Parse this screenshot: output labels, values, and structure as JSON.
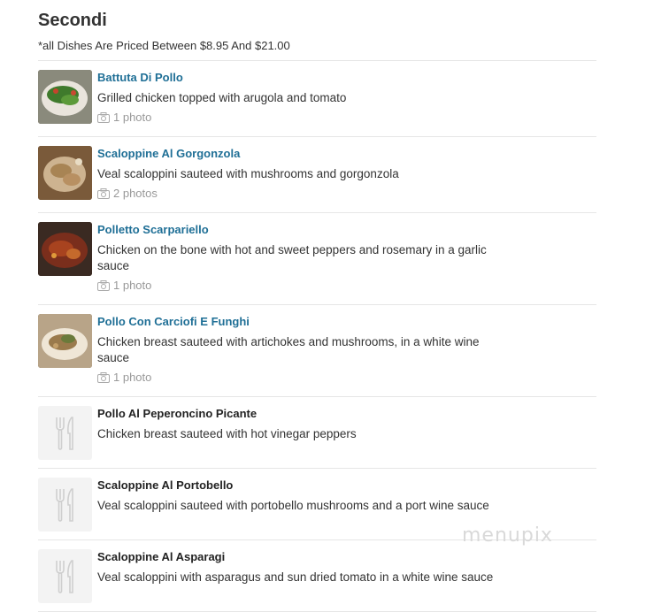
{
  "section": {
    "title": "Secondi",
    "note": "*all Dishes Are Priced Between $8.95 And $21.00"
  },
  "items": [
    {
      "name": "Battuta Di Pollo",
      "description": "Grilled chicken topped with arugola and tomato",
      "photos": "1 photo"
    },
    {
      "name": "Scaloppine Al Gorgonzola",
      "description": "Veal scaloppini sauteed with mushrooms and gorgonzola",
      "photos": "2 photos"
    },
    {
      "name": "Polletto Scarpariello",
      "description": "Chicken on the bone with hot and sweet peppers and rosemary in a garlic sauce",
      "photos": "1 photo"
    },
    {
      "name": "Pollo Con Carciofi E Funghi",
      "description": "Chicken breast sauteed with artichokes and mushrooms, in a white wine sauce",
      "photos": "1 photo"
    },
    {
      "name": "Pollo Al Peperoncino Picante",
      "description": "Chicken breast sauteed with hot vinegar peppers"
    },
    {
      "name": "Scaloppine Al Portobello",
      "description": "Veal scaloppini sauteed with portobello mushrooms and a port wine sauce"
    },
    {
      "name": "Scaloppine Al Asparagi",
      "description": "Veal scaloppini with asparagus and sun dried tomato in a white wine sauce"
    }
  ],
  "watermark": "menupix",
  "colors": {
    "link": "#1f6f96",
    "divider": "#e6e6e6",
    "muted": "#999999"
  }
}
